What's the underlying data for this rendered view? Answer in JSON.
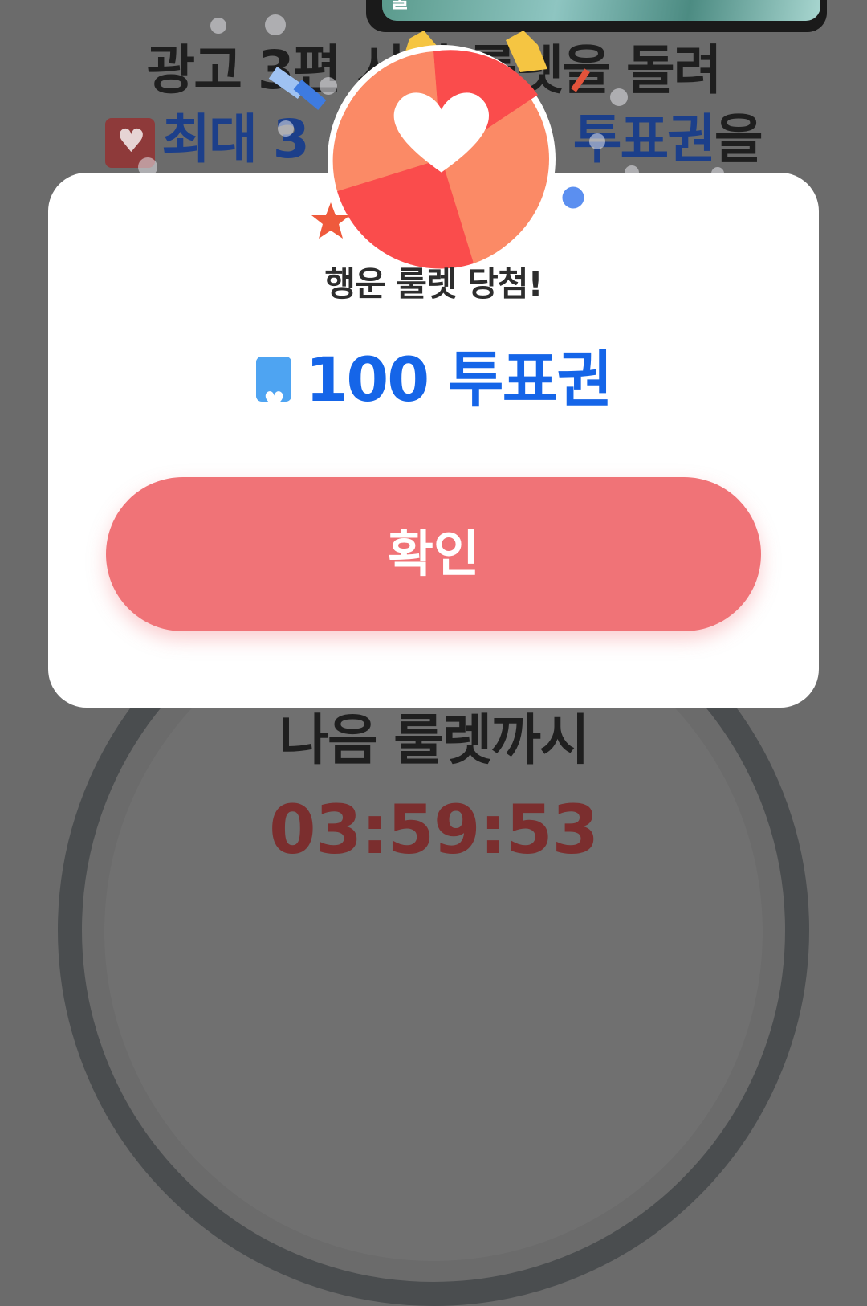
{
  "background": {
    "headline_line1": "광고 3편 시청 룰렛을 돌려",
    "headline_line2_accent": "최대 3",
    "headline_line2_suffix_accent": "투표권",
    "headline_line2_suffix": "을",
    "thumbnail_label": "줄",
    "timer_label": "나음 룰렛까시",
    "timer_value": "03:59:53"
  },
  "modal": {
    "title": "행운 룰렛 당첨!",
    "prize_amount": "100",
    "prize_unit": "투표권",
    "confirm_label": "확인"
  },
  "icons": {
    "wheel": "roulette-heart-icon",
    "prize": "vote-ticket-heart-icon",
    "star": "star-icon"
  },
  "colors": {
    "accent_blue": "#1565e8",
    "confirm_button": "#f07377",
    "wheel_red": "#fa4c4c",
    "wheel_orange": "#fb8a66",
    "star_yellow": "#f5c542",
    "overlay": "#6b6b6b"
  }
}
